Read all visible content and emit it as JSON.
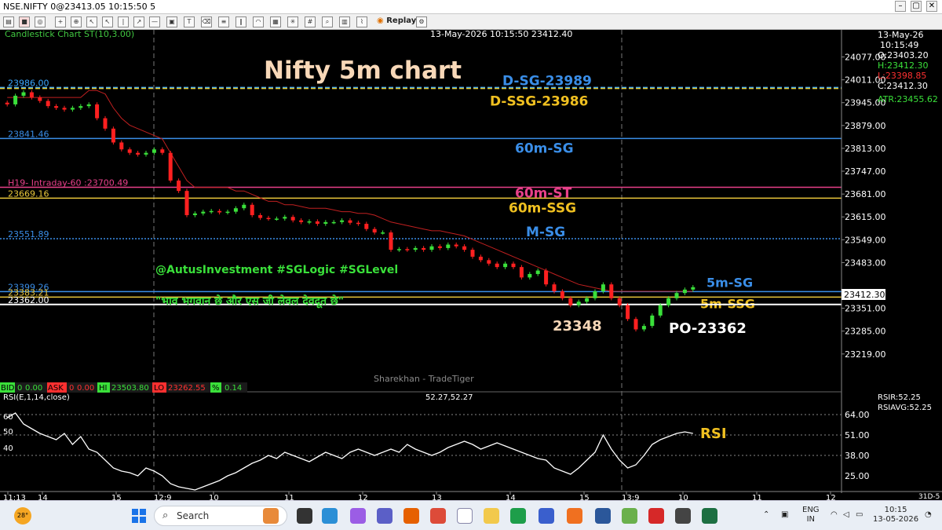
{
  "window": {
    "title": "NSE.NIFTY 0@23413.05 10:15:50 5",
    "buttons": [
      "–",
      "▢",
      "✕"
    ]
  },
  "toolbar": {
    "replay_label": "Replay"
  },
  "chart": {
    "chart_label": "Candlestick Chart   ST(10,3.00)",
    "header_time": "13-May-2026 10:15:50 23412.40",
    "title": "Nifty 5m chart",
    "watermark": "Sharekhan - TradeTiger",
    "ohlc": {
      "date": "13-May-26",
      "time": "10:15:49",
      "open": "O:23403.20",
      "high": "H:23412.30",
      "low": "L:23398.85",
      "close": "C:23412.30",
      "atr": "ATR:23455.62"
    },
    "levels": [
      {
        "id": "dsg",
        "price_label": "23986.00",
        "price": 23989,
        "color": "#3aa7ff",
        "text": "D-SG-23989",
        "text_color": "#3a8ee8",
        "dashed": true
      },
      {
        "id": "dssg",
        "price_label": "",
        "price": 23986,
        "color": "#e8d23a",
        "text": "D-SSG-23986",
        "text_color": "#f0c020",
        "dashed": true
      },
      {
        "id": "60msg",
        "price_label": "23841.46",
        "price": 23841.46,
        "color": "#3a8ee8",
        "text": "60m-SG",
        "text_color": "#3a8ee8",
        "dashed": false
      },
      {
        "id": "60mst",
        "price_label": "H19- Intraday-60 :23700.49",
        "price": 23700.49,
        "color": "#e8408a",
        "text": "60m-ST",
        "text_color": "#e8408a",
        "dashed": false
      },
      {
        "id": "60mssg",
        "price_label": "23669.16",
        "price": 23669.16,
        "color": "#e8c53a",
        "text": "60m-SSG",
        "text_color": "#f0c020",
        "dashed": false
      },
      {
        "id": "msg",
        "price_label": "23551.89",
        "price": 23551.89,
        "color": "#3a8ee8",
        "text": "M-SG",
        "text_color": "#3a8ee8",
        "dashed": true
      },
      {
        "id": "5msg",
        "price_label": "23399.26",
        "price": 23399.26,
        "color": "#3a8ee8",
        "text": "5m-SG",
        "text_color": "#3a8ee8",
        "dashed": false
      },
      {
        "id": "5mssg",
        "price_label": "23383.21",
        "price": 23383.21,
        "color": "#e8c53a",
        "text": "5m-SSG",
        "text_color": "#f0c020",
        "dashed": false
      },
      {
        "id": "po",
        "price_label": "23362.00",
        "price": 23362,
        "color": "#ffffff",
        "text": "",
        "text_color": "#ffffff",
        "dashed": false
      }
    ],
    "annotations": {
      "low_label": "23348",
      "po_label": "PO-23362",
      "handle": "@AutusInvestment #SGLogic #SGLevel",
      "hindi": "\"भाव भगवान छे और एस जी लेवल देवदूत छे\"",
      "rsi_label": "RSI"
    },
    "current_price": "23412.30",
    "quote_bar": {
      "bid_label": "BID",
      "bid_qty": "0",
      "bid": "0.00",
      "ask_label": "ASK",
      "ask_qty": "0",
      "ask": "0.00",
      "hi_label": "HI",
      "hi": "23503.80",
      "lo_label": "LO",
      "lo": "23262.55",
      "pct_label": "%",
      "pct": "0.14"
    },
    "rsi": {
      "label": "RSI(E,1,14,close)",
      "value": "52.27,52.27",
      "rsir": "RSIR:52.25",
      "rsiavg": "RSIAVG:52.25",
      "left_ticks": [
        "60",
        "50",
        "40"
      ]
    },
    "corner_label": "31D-5"
  },
  "chart_data": [
    {
      "type": "line",
      "title": "Nifty 5m chart",
      "y_ticks": [
        "24077.00",
        "24011.00",
        "23945.00",
        "23879.00",
        "23813.00",
        "23747.00",
        "23681.00",
        "23615.00",
        "23549.00",
        "23483.00",
        "23351.00",
        "23285.00",
        "23219.00"
      ],
      "x_ticks": [
        "11:13",
        "14",
        "15",
        "12:9",
        "10",
        "11",
        "12",
        "13",
        "14",
        "15",
        "13:9",
        "10",
        "11",
        "12"
      ],
      "ylim": [
        23180,
        24110
      ],
      "candles_close": [
        23940,
        23965,
        23975,
        23960,
        23950,
        23935,
        23930,
        23925,
        23930,
        23935,
        23940,
        23900,
        23870,
        23830,
        23810,
        23800,
        23795,
        23800,
        23810,
        23800,
        23720,
        23690,
        23620,
        23625,
        23630,
        23632,
        23628,
        23630,
        23640,
        23650,
        23620,
        23612,
        23610,
        23610,
        23615,
        23605,
        23600,
        23602,
        23595,
        23600,
        23600,
        23605,
        23598,
        23595,
        23580,
        23570,
        23570,
        23520,
        23522,
        23520,
        23525,
        23520,
        23530,
        23525,
        23535,
        23530,
        23520,
        23500,
        23490,
        23480,
        23470,
        23480,
        23470,
        23440,
        23450,
        23460,
        23420,
        23400,
        23380,
        23360,
        23370,
        23380,
        23400,
        23420,
        23380,
        23360,
        23320,
        23290,
        23300,
        23330,
        23360,
        23380,
        23395,
        23405,
        23412
      ],
      "supertrend": [
        23960,
        23960,
        23960,
        23960,
        23960,
        23960,
        23960,
        23960,
        23960,
        23960,
        23980,
        23980,
        23970,
        23930,
        23900,
        23880,
        23870,
        23860,
        23850,
        23840,
        23800,
        23760,
        23720,
        23700,
        23700,
        23700,
        23700,
        23700,
        23690,
        23690,
        23680,
        23670,
        23660,
        23660,
        23650,
        23650,
        23645,
        23640,
        23640,
        23640,
        23635,
        23630,
        23630,
        23625,
        23625,
        23620,
        23610,
        23600,
        23595,
        23590,
        23585,
        23580,
        23575,
        23575,
        23570,
        23565,
        23560,
        23550,
        23540,
        23530,
        23520,
        23510,
        23500,
        23490,
        23480,
        23470,
        23460,
        23450,
        23440,
        23430,
        23420,
        23415,
        23410,
        23405,
        23400,
        23400,
        23400,
        23400,
        23400,
        23400,
        23400,
        23400,
        23400,
        23400,
        23400
      ]
    },
    {
      "type": "line",
      "title": "RSI(E,1,14,close)",
      "y_ticks": [
        "64.00",
        "51.00",
        "38.00",
        "25.00"
      ],
      "ylim": [
        15,
        72
      ],
      "values": [
        62,
        65,
        58,
        55,
        52,
        50,
        48,
        52,
        45,
        50,
        42,
        40,
        35,
        30,
        28,
        27,
        25,
        30,
        28,
        25,
        20,
        18,
        17,
        16,
        18,
        20,
        22,
        25,
        27,
        30,
        33,
        35,
        38,
        36,
        40,
        38,
        36,
        34,
        37,
        40,
        38,
        36,
        40,
        42,
        40,
        38,
        40,
        42,
        40,
        45,
        42,
        40,
        38,
        40,
        43,
        45,
        47,
        45,
        42,
        44,
        46,
        44,
        42,
        40,
        38,
        36,
        35,
        30,
        28,
        26,
        30,
        35,
        40,
        51,
        42,
        35,
        30,
        32,
        38,
        45,
        48,
        50,
        52,
        53,
        52
      ]
    }
  ]
}
